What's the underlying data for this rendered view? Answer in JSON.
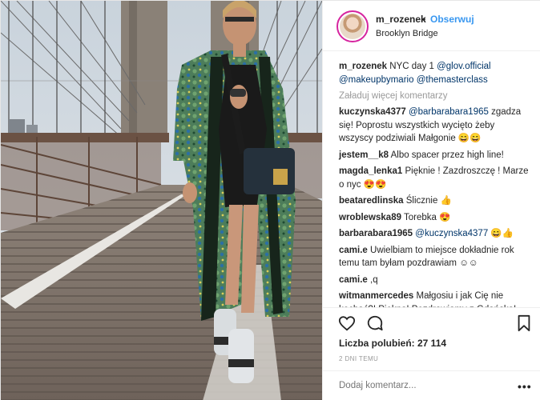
{
  "post": {
    "header": {
      "username": "m_rozenek",
      "separator": "•",
      "follow_label": "Obserwuj",
      "location": "Brooklyn Bridge"
    },
    "caption": {
      "author": "m_rozenek",
      "text": "NYC day 1 ",
      "mention_1": "@glov.official",
      "mention_2": "@makeupbymario",
      "mention_3": "@themasterclass"
    },
    "load_more": "Załaduj więcej komentarzy",
    "comments": [
      {
        "author": "kuczynska4377",
        "mention": "@barbarabara1965",
        "text": " zgadza się! Poprostu wszystkich wycięto żeby wszyscy podziwiali Małgonie 😄😄"
      },
      {
        "author": "jestem__k8",
        "mention": "",
        "text": " Albo spacer przez high line!"
      },
      {
        "author": "magda_lenka1",
        "mention": "",
        "text": " Pięknie ! Zazdroszczę ! Marze o nyc 😍😍"
      },
      {
        "author": "beatаredlinska",
        "mention": "",
        "text": " Ślicznie 👍"
      },
      {
        "author": "wroblewska89",
        "mention": "",
        "text": " Torebka 😍"
      },
      {
        "author": "barbarabara1965",
        "mention": "@kuczynska4377",
        "text": " 😄👍"
      },
      {
        "author": "cami.e",
        "mention": "",
        "text": " Uwielbiam to miejsce dokładnie rok temu tam byłam pozdrawiam ☺☺"
      },
      {
        "author": "cami.e",
        "mention": "",
        "text": " ,q"
      },
      {
        "author": "witmanmercedes",
        "mention": "",
        "text": " Małgosiu i jak Cię nie kochać?! Piękna! Pozdrawiamy z Gdańska!"
      }
    ],
    "likes": "Liczba polubień: 27 114",
    "date": "2 DNI TEMU",
    "add_comment_placeholder": "Dodaj komentarz...",
    "more_label": "•••",
    "icons": {
      "like": "heart-icon",
      "comment": "comment-bubble-icon",
      "save": "bookmark-icon"
    },
    "colors": {
      "follow": "#3897f0",
      "mention": "#003569",
      "muted": "#999999"
    }
  }
}
